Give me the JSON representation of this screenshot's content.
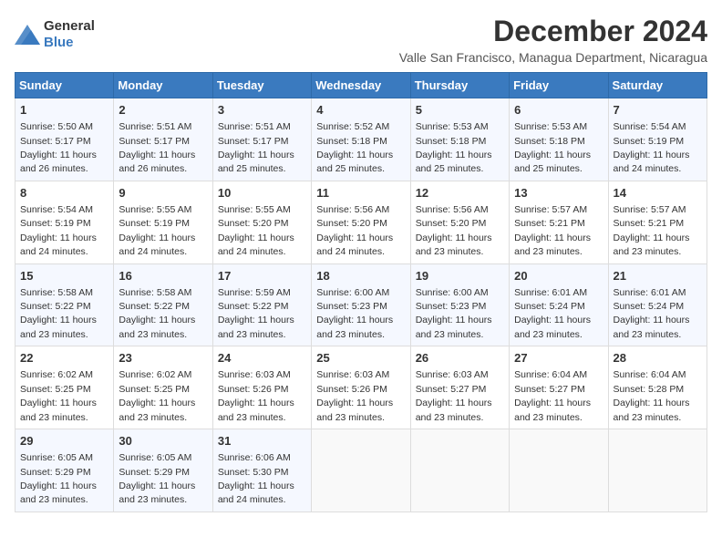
{
  "header": {
    "logo_general": "General",
    "logo_blue": "Blue",
    "title": "December 2024",
    "subtitle": "Valle San Francisco, Managua Department, Nicaragua"
  },
  "calendar": {
    "days_of_week": [
      "Sunday",
      "Monday",
      "Tuesday",
      "Wednesday",
      "Thursday",
      "Friday",
      "Saturday"
    ],
    "weeks": [
      [
        {
          "day": "",
          "info": ""
        },
        {
          "day": "2",
          "info": "Sunrise: 5:51 AM\nSunset: 5:17 PM\nDaylight: 11 hours\nand 26 minutes."
        },
        {
          "day": "3",
          "info": "Sunrise: 5:51 AM\nSunset: 5:17 PM\nDaylight: 11 hours\nand 25 minutes."
        },
        {
          "day": "4",
          "info": "Sunrise: 5:52 AM\nSunset: 5:18 PM\nDaylight: 11 hours\nand 25 minutes."
        },
        {
          "day": "5",
          "info": "Sunrise: 5:53 AM\nSunset: 5:18 PM\nDaylight: 11 hours\nand 25 minutes."
        },
        {
          "day": "6",
          "info": "Sunrise: 5:53 AM\nSunset: 5:18 PM\nDaylight: 11 hours\nand 25 minutes."
        },
        {
          "day": "7",
          "info": "Sunrise: 5:54 AM\nSunset: 5:19 PM\nDaylight: 11 hours\nand 24 minutes."
        }
      ],
      [
        {
          "day": "1",
          "info": "Sunrise: 5:50 AM\nSunset: 5:17 PM\nDaylight: 11 hours\nand 26 minutes."
        },
        {
          "day": "9",
          "info": "Sunrise: 5:55 AM\nSunset: 5:19 PM\nDaylight: 11 hours\nand 24 minutes."
        },
        {
          "day": "10",
          "info": "Sunrise: 5:55 AM\nSunset: 5:20 PM\nDaylight: 11 hours\nand 24 minutes."
        },
        {
          "day": "11",
          "info": "Sunrise: 5:56 AM\nSunset: 5:20 PM\nDaylight: 11 hours\nand 24 minutes."
        },
        {
          "day": "12",
          "info": "Sunrise: 5:56 AM\nSunset: 5:20 PM\nDaylight: 11 hours\nand 23 minutes."
        },
        {
          "day": "13",
          "info": "Sunrise: 5:57 AM\nSunset: 5:21 PM\nDaylight: 11 hours\nand 23 minutes."
        },
        {
          "day": "14",
          "info": "Sunrise: 5:57 AM\nSunset: 5:21 PM\nDaylight: 11 hours\nand 23 minutes."
        }
      ],
      [
        {
          "day": "8",
          "info": "Sunrise: 5:54 AM\nSunset: 5:19 PM\nDaylight: 11 hours\nand 24 minutes."
        },
        {
          "day": "16",
          "info": "Sunrise: 5:58 AM\nSunset: 5:22 PM\nDaylight: 11 hours\nand 23 minutes."
        },
        {
          "day": "17",
          "info": "Sunrise: 5:59 AM\nSunset: 5:22 PM\nDaylight: 11 hours\nand 23 minutes."
        },
        {
          "day": "18",
          "info": "Sunrise: 6:00 AM\nSunset: 5:23 PM\nDaylight: 11 hours\nand 23 minutes."
        },
        {
          "day": "19",
          "info": "Sunrise: 6:00 AM\nSunset: 5:23 PM\nDaylight: 11 hours\nand 23 minutes."
        },
        {
          "day": "20",
          "info": "Sunrise: 6:01 AM\nSunset: 5:24 PM\nDaylight: 11 hours\nand 23 minutes."
        },
        {
          "day": "21",
          "info": "Sunrise: 6:01 AM\nSunset: 5:24 PM\nDaylight: 11 hours\nand 23 minutes."
        }
      ],
      [
        {
          "day": "15",
          "info": "Sunrise: 5:58 AM\nSunset: 5:22 PM\nDaylight: 11 hours\nand 23 minutes."
        },
        {
          "day": "23",
          "info": "Sunrise: 6:02 AM\nSunset: 5:25 PM\nDaylight: 11 hours\nand 23 minutes."
        },
        {
          "day": "24",
          "info": "Sunrise: 6:03 AM\nSunset: 5:26 PM\nDaylight: 11 hours\nand 23 minutes."
        },
        {
          "day": "25",
          "info": "Sunrise: 6:03 AM\nSunset: 5:26 PM\nDaylight: 11 hours\nand 23 minutes."
        },
        {
          "day": "26",
          "info": "Sunrise: 6:03 AM\nSunset: 5:27 PM\nDaylight: 11 hours\nand 23 minutes."
        },
        {
          "day": "27",
          "info": "Sunrise: 6:04 AM\nSunset: 5:27 PM\nDaylight: 11 hours\nand 23 minutes."
        },
        {
          "day": "28",
          "info": "Sunrise: 6:04 AM\nSunset: 5:28 PM\nDaylight: 11 hours\nand 23 minutes."
        }
      ],
      [
        {
          "day": "22",
          "info": "Sunrise: 6:02 AM\nSunset: 5:25 PM\nDaylight: 11 hours\nand 23 minutes."
        },
        {
          "day": "30",
          "info": "Sunrise: 6:05 AM\nSunset: 5:29 PM\nDaylight: 11 hours\nand 23 minutes."
        },
        {
          "day": "31",
          "info": "Sunrise: 6:06 AM\nSunset: 5:30 PM\nDaylight: 11 hours\nand 24 minutes."
        },
        {
          "day": "",
          "info": ""
        },
        {
          "day": "",
          "info": ""
        },
        {
          "day": "",
          "info": ""
        },
        {
          "day": "",
          "info": ""
        }
      ],
      [
        {
          "day": "29",
          "info": "Sunrise: 6:05 AM\nSunset: 5:29 PM\nDaylight: 11 hours\nand 23 minutes."
        },
        {
          "day": "",
          "info": ""
        },
        {
          "day": "",
          "info": ""
        },
        {
          "day": "",
          "info": ""
        },
        {
          "day": "",
          "info": ""
        },
        {
          "day": "",
          "info": ""
        },
        {
          "day": "",
          "info": ""
        }
      ]
    ]
  }
}
